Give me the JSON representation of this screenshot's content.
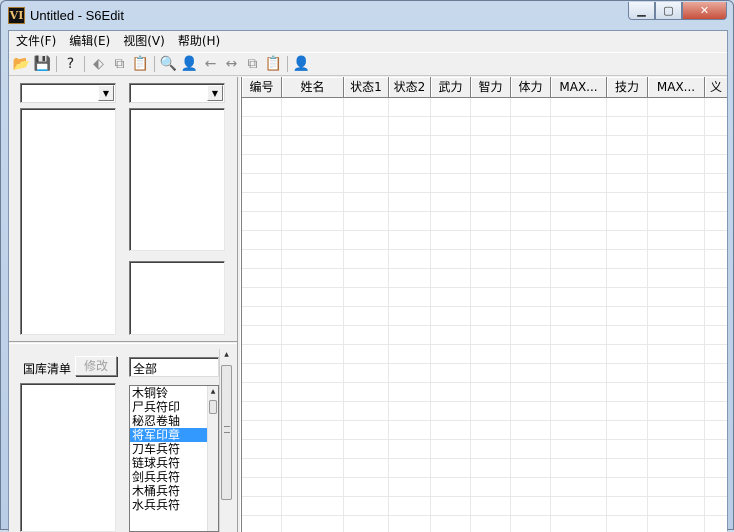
{
  "window": {
    "icon_text": "VI",
    "title": "Untitled - S6Edit",
    "controls": {
      "minimize": "▁",
      "maximize": "▢",
      "close": "✕"
    }
  },
  "menu": [
    "文件(F)",
    "编辑(E)",
    "视图(V)",
    "帮助(H)"
  ],
  "toolbar": [
    {
      "name": "open-icon",
      "glyph": "📂",
      "enabled": true
    },
    {
      "name": "save-icon",
      "glyph": "💾",
      "enabled": false
    },
    {
      "name": "sep"
    },
    {
      "name": "help-icon",
      "glyph": "?",
      "enabled": true
    },
    {
      "name": "sep"
    },
    {
      "name": "tag-icon",
      "glyph": "⬖",
      "enabled": false
    },
    {
      "name": "copy-icon",
      "glyph": "⧉",
      "enabled": false
    },
    {
      "name": "paste-icon",
      "glyph": "📋",
      "enabled": false
    },
    {
      "name": "sep"
    },
    {
      "name": "find-icon",
      "glyph": "🔍",
      "enabled": false
    },
    {
      "name": "person-icon",
      "glyph": "👤",
      "enabled": false
    },
    {
      "name": "arrow-left-icon",
      "glyph": "←",
      "enabled": false
    },
    {
      "name": "arrow-both-icon",
      "glyph": "↔",
      "enabled": false
    },
    {
      "name": "copy2-icon",
      "glyph": "⧉",
      "enabled": false
    },
    {
      "name": "paste2-icon",
      "glyph": "📋",
      "enabled": false
    },
    {
      "name": "sep"
    },
    {
      "name": "person2-icon",
      "glyph": "👤",
      "enabled": false
    }
  ],
  "left": {
    "combo1_value": "",
    "combo2_value": "",
    "warehouse_label": "国库清单",
    "modify_button": "修改",
    "filter_value": "全部",
    "items": [
      "木铜铃",
      "尸兵符印",
      "秘忍卷轴",
      "将军印章",
      "刀车兵符",
      "链球兵符",
      "剑兵兵符",
      "木桶兵符",
      "水兵兵符"
    ],
    "selected_index": 3
  },
  "grid": {
    "columns": [
      "编号",
      "姓名",
      "状态1",
      "状态2",
      "武力",
      "智力",
      "体力",
      "MAX...",
      "技力",
      "MAX...",
      "义"
    ]
  }
}
